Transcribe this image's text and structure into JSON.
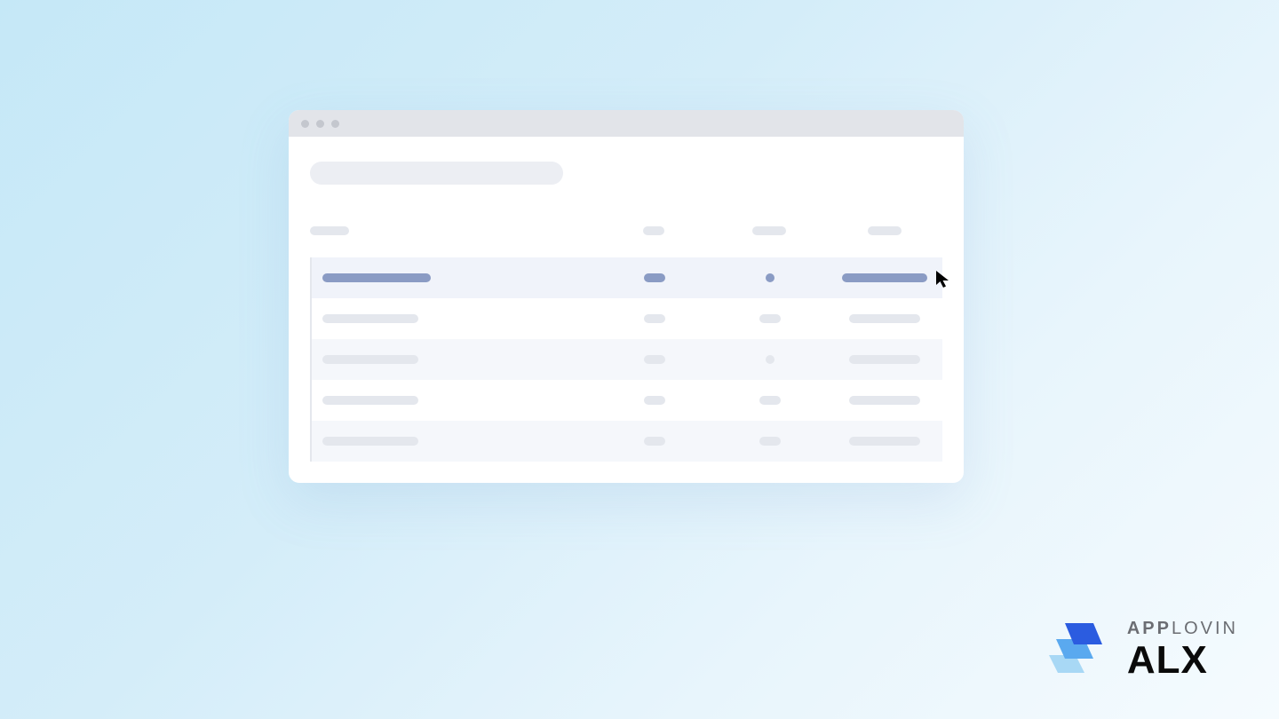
{
  "logo": {
    "brand_prefix": "APP",
    "brand_suffix": "LOVIN",
    "product": "ALX"
  },
  "window": {
    "has_traffic_lights": true
  },
  "table": {
    "columns": 4,
    "rows": 5,
    "selected_row_index": 0
  },
  "colors": {
    "accent": "#8a9bc4",
    "placeholder": "#e4e7ed",
    "stripe": "#f5f7fb"
  }
}
